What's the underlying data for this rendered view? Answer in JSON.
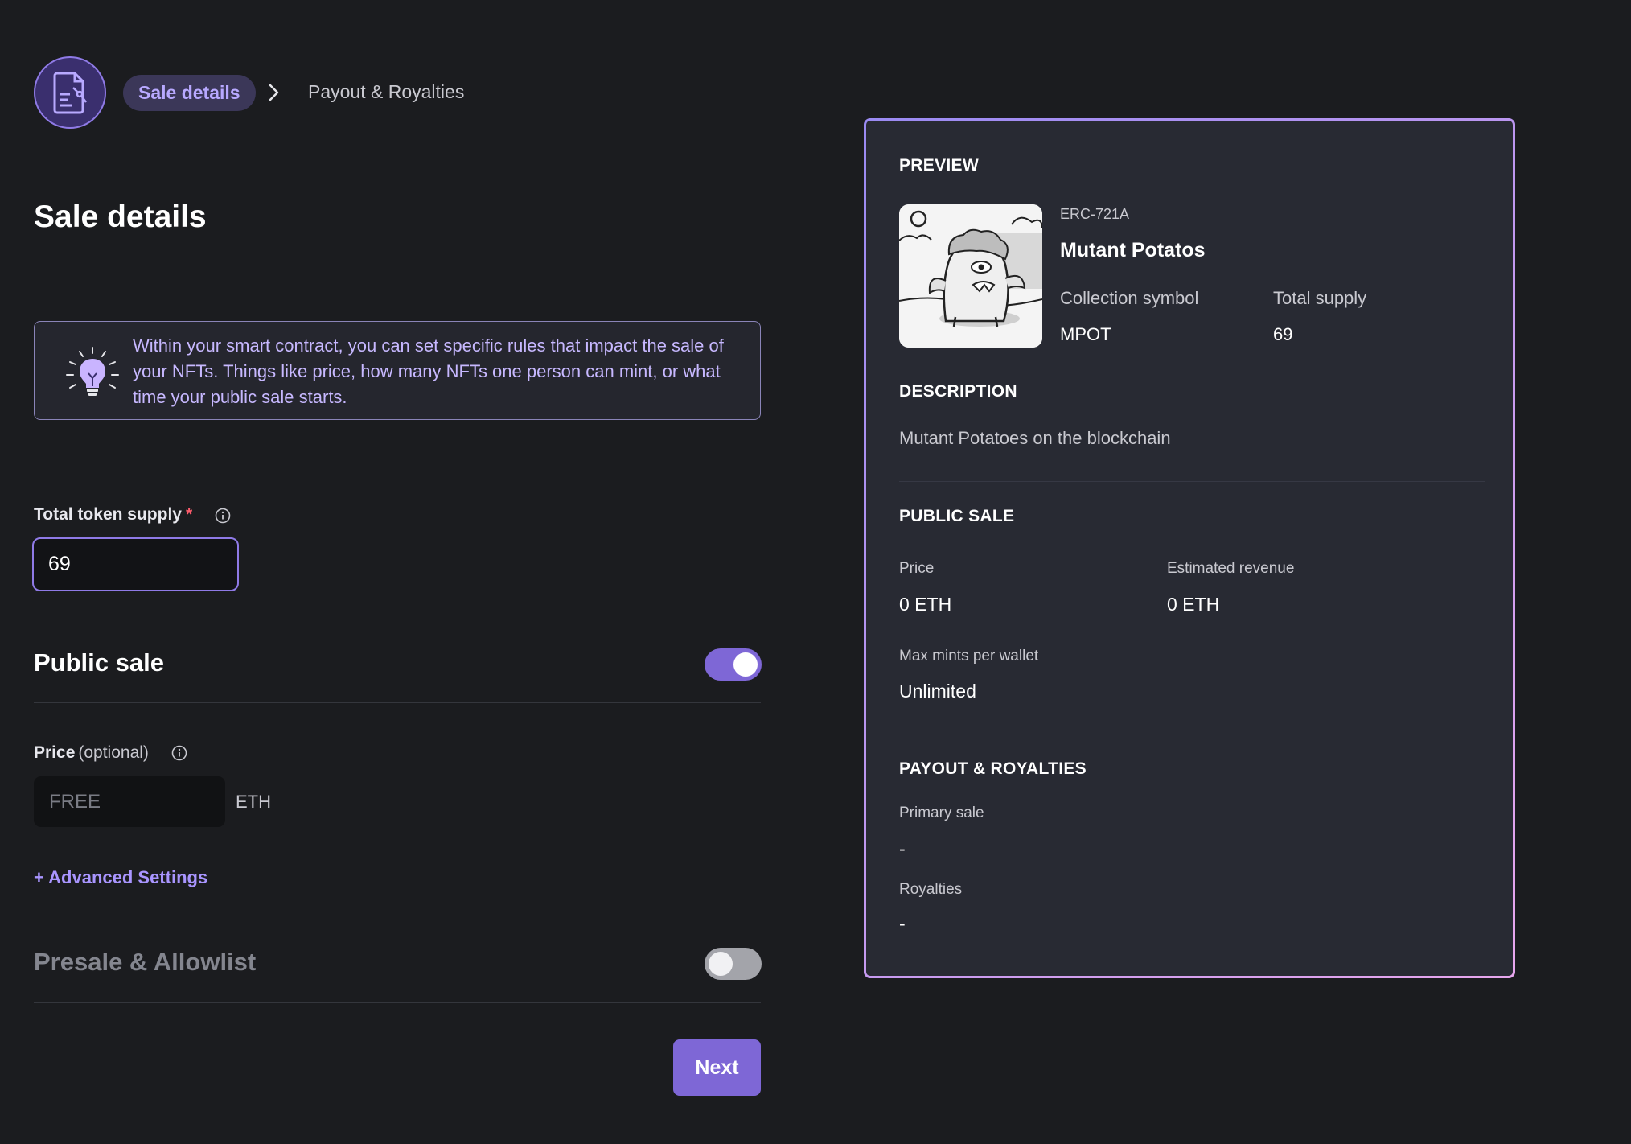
{
  "stepper": {
    "icon": "contract-document-icon",
    "current_step": "Sale details",
    "next_step": "Payout & Royalties",
    "separator_icon": "chevron-right-icon"
  },
  "page_title": "Sale details",
  "info": {
    "icon": "lightbulb-icon",
    "text": "Within your smart contract, you can set specific rules that impact the sale of your NFTs. Things like price, how many NFTs one person can mint, or what time your public sale starts."
  },
  "supply": {
    "label": "Total token supply",
    "required_mark": "*",
    "value": "69"
  },
  "public_sale": {
    "title": "Public sale",
    "enabled": true,
    "price_label": "Price",
    "price_optional": "(optional)",
    "price_placeholder": "FREE",
    "price_unit": "ETH",
    "advanced_link": "+ Advanced Settings"
  },
  "presale": {
    "title": "Presale & Allowlist",
    "enabled": false
  },
  "next_button": "Next",
  "preview": {
    "heading": "PREVIEW",
    "standard": "ERC-721A",
    "name": "Mutant Potatos",
    "symbol_label": "Collection symbol",
    "symbol_value": "MPOT",
    "supply_label": "Total supply",
    "supply_value": "69",
    "description_heading": "DESCRIPTION",
    "description": "Mutant Potatoes on the blockchain",
    "public_sale_heading": "PUBLIC SALE",
    "price_label": "Price",
    "price_value": "0 ETH",
    "revenue_label": "Estimated revenue",
    "revenue_value": "0 ETH",
    "max_mints_label": "Max mints per wallet",
    "max_mints_value": "Unlimited",
    "payout_heading": "PAYOUT & ROYALTIES",
    "primary_sale_label": "Primary sale",
    "primary_sale_value": "-",
    "royalties_label": "Royalties",
    "royalties_value": "-"
  },
  "colors": {
    "accent": "#7e67d6",
    "accent_text": "#b8a9ff",
    "background": "#1b1c1f",
    "card": "#282a33",
    "required": "#ff5c6c"
  }
}
